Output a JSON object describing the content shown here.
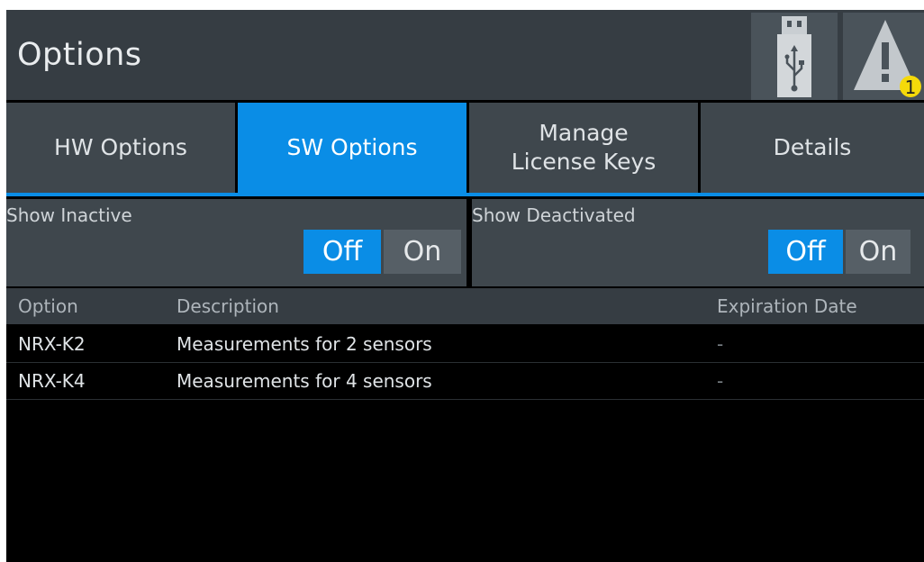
{
  "header": {
    "title": "Options",
    "usb_icon": "usb-icon",
    "warning_icon": "warning-icon",
    "warning_count": "1",
    "warning_badge_color": "#f5d90a"
  },
  "tabs": [
    {
      "label": "HW Options",
      "active": false
    },
    {
      "label": "SW Options",
      "active": true
    },
    {
      "label": "Manage\nLicense Keys",
      "active": false
    },
    {
      "label": "Details",
      "active": false
    }
  ],
  "filters": {
    "show_inactive": {
      "label": "Show Inactive",
      "off": "Off",
      "on": "On",
      "value": "Off"
    },
    "show_deactivated": {
      "label": "Show Deactivated",
      "off": "Off",
      "on": "On",
      "value": "Off"
    }
  },
  "table": {
    "columns": [
      "Option",
      "Description",
      "Expiration Date"
    ],
    "rows": [
      {
        "option": "NRX-K2",
        "description": "Measurements for 2 sensors",
        "expiration": "-"
      },
      {
        "option": "NRX-K4",
        "description": "Measurements for 4 sensors",
        "expiration": "-"
      }
    ]
  },
  "colors": {
    "accent": "#0a8de6",
    "header_bg": "#363d43",
    "panel_bg": "#3f474d",
    "background": "#000000"
  }
}
